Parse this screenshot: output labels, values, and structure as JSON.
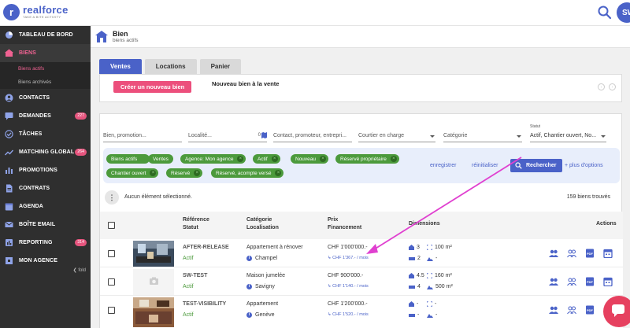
{
  "app": {
    "logo_letter": "r",
    "name": "realforce",
    "tagline": "TAKE A BITE ACTIVITY",
    "user_initials": "SW"
  },
  "sidebar": {
    "items": [
      {
        "label": "TABLEAU DE BORD",
        "icon": "dashboard-icon"
      },
      {
        "label": "BIENS",
        "icon": "building-icon"
      },
      {
        "label": "CONTACTS",
        "icon": "user-icon"
      },
      {
        "label": "DEMANDES",
        "icon": "chat-icon",
        "badge": "227"
      },
      {
        "label": "TÂCHES",
        "icon": "check-circle-icon"
      },
      {
        "label": "MATCHING GLOBAL",
        "icon": "trending-icon",
        "badge": "264"
      },
      {
        "label": "PROMOTIONS",
        "icon": "chart-bar-icon"
      },
      {
        "label": "CONTRATS",
        "icon": "document-icon"
      },
      {
        "label": "AGENDA",
        "icon": "calendar-icon"
      },
      {
        "label": "BOÎTE EMAIL",
        "icon": "mail-icon"
      },
      {
        "label": "REPORTING",
        "icon": "report-icon",
        "badge": "314"
      },
      {
        "label": "MON AGENCE",
        "icon": "agency-icon"
      }
    ],
    "sub_items": [
      "Biens actifs",
      "Biens archivés"
    ],
    "fold": "❮ fold"
  },
  "header": {
    "title": "Bien",
    "subtitle": "biens actifs"
  },
  "tabs": [
    "Ventes",
    "Locations",
    "Panier"
  ],
  "create": {
    "button": "Créer un nouveau bien",
    "title": "Nouveau bien à la vente"
  },
  "filters": {
    "search_placeholder": "Bien, promotion...",
    "locality_placeholder": "Localité...",
    "locality_count": "0",
    "contact_placeholder": "Contact, promoteur, entrepri...",
    "broker_placeholder": "Courtier en charge",
    "category_placeholder": "Catégorie",
    "status_label": "Statut",
    "status_value": "Actif, Chantier ouvert, No..."
  },
  "chips": [
    "Biens actifs",
    "Ventes",
    "Agence: Mon agence",
    "Actif",
    "Nouveau",
    "Réservé propriétaire",
    "Chantier ouvert",
    "Réservé",
    "Réservé, acompte versé"
  ],
  "actions": {
    "save": "enregistrer",
    "reset": "réinitialiser",
    "search": "Rechercher",
    "more_options": "+ plus d'options"
  },
  "selection": {
    "text": "Aucun élément sélectionné.",
    "count": "159 biens trouvés"
  },
  "table": {
    "headers": {
      "ref": "Référence",
      "status": "Statut",
      "category": "Catégorie",
      "location": "Localisation",
      "price": "Prix",
      "financing": "Financement",
      "dimensions": "Dimensions",
      "actions": "Actions"
    },
    "rows": [
      {
        "ref": "AFTER-RELEASE",
        "status": "Actif",
        "category": "Appartement à rénover",
        "location": "Champel",
        "price": "CHF 1'000'000.-",
        "financing": "↳ CHF 1'367.- / mois",
        "rooms": "3",
        "surface": "100 m²",
        "bath": "2",
        "land": "-"
      },
      {
        "ref": "SW-TEST",
        "status": "Actif",
        "category": "Maison jumelée",
        "location": "Savigny",
        "price": "CHF 900'000.-",
        "financing": "↳ CHF 1'140.- / mois",
        "rooms": "4.5",
        "surface": "160 m²",
        "bath": "4",
        "land": "500 m²"
      },
      {
        "ref": "TEST-VISIBILITY",
        "status": "Actif",
        "category": "Appartement",
        "location": "Genève",
        "price": "CHF 1'200'000.-",
        "financing": "↳ CHF 1'520.- / mois",
        "rooms": "-",
        "surface": "-",
        "bath": "-",
        "land": "-"
      }
    ]
  },
  "colors": {
    "primary": "#4a62c8",
    "accent": "#ec4f7c",
    "chip": "#4c9a3c",
    "sidebar": "#2f2f2f",
    "arrow": "#e040d0"
  }
}
